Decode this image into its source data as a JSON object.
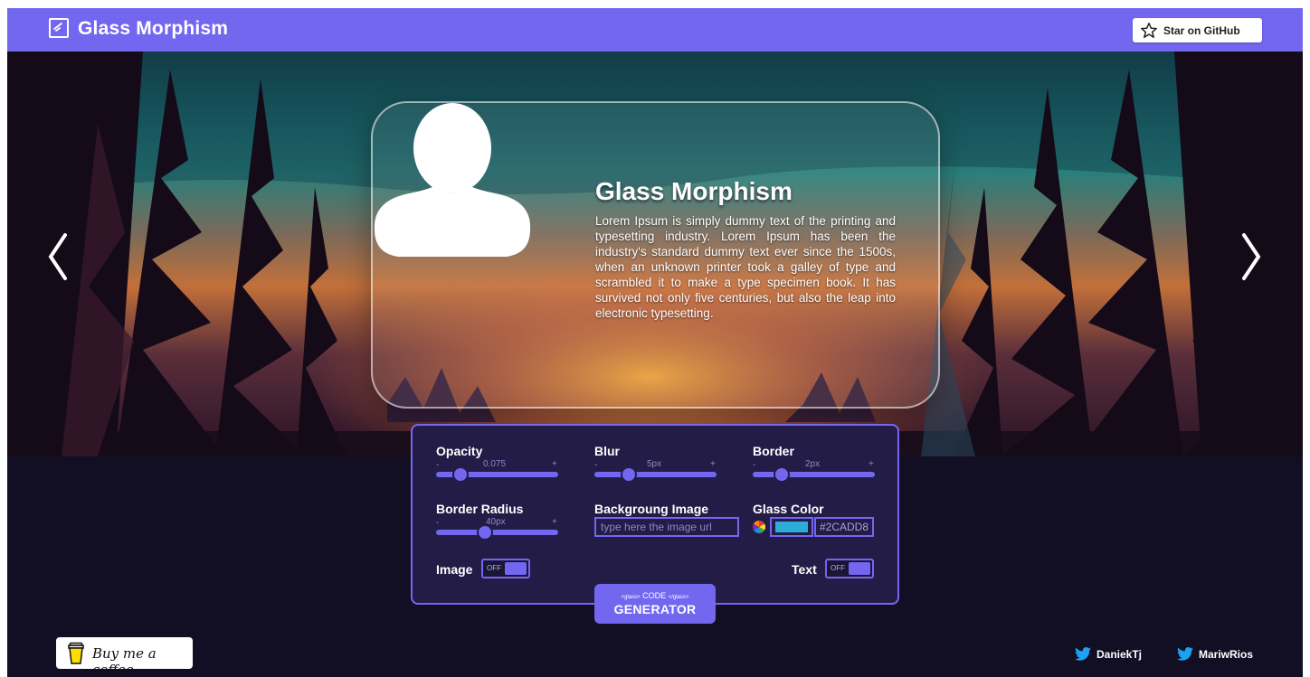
{
  "header": {
    "title": "Glass Morphism",
    "github_label": "Star on GitHub"
  },
  "card": {
    "title": "Glass Morphism",
    "text": "Lorem Ipsum is simply dummy text of the printing and typesetting industry. Lorem Ipsum has been the industry's standard dummy text ever since the 1500s, when an unknown printer took a galley of type and scrambled it to make a type specimen book. It has survived not only five centuries, but also the leap into electronic typesetting."
  },
  "controls": {
    "opacity": {
      "label": "Opacity",
      "value": "0.075",
      "minus": "-",
      "plus": "+",
      "level": 0.2
    },
    "blur": {
      "label": "Blur",
      "value": "5px",
      "minus": "-",
      "plus": "+",
      "level": 0.28
    },
    "border": {
      "label": "Border",
      "value": "2px",
      "minus": "-",
      "plus": "+",
      "level": 0.24
    },
    "border_radius": {
      "label": "Border Radius",
      "value": "40px",
      "minus": "-",
      "plus": "+",
      "level": 0.4
    },
    "background_image": {
      "label": "Backgroung Image",
      "placeholder": "type here the image url"
    },
    "glass_color": {
      "label": "Glass Color",
      "hex": "#2CADD8",
      "color": "#2cadd8"
    },
    "image_toggle": {
      "label": "Image",
      "state": "OFF"
    },
    "text_toggle": {
      "label": "Text",
      "state": "OFF"
    }
  },
  "generator": {
    "open_tag": "<glass>",
    "code": "CODE",
    "close_tag": "</glass>",
    "label": "GENERATOR"
  },
  "footer": {
    "coffee_label": "Buy me a coffee",
    "social": [
      "DaniekTj",
      "MariwRios"
    ]
  },
  "colors": {
    "accent": "#7367f0",
    "background": "#120e24",
    "panel": "#231c47"
  }
}
